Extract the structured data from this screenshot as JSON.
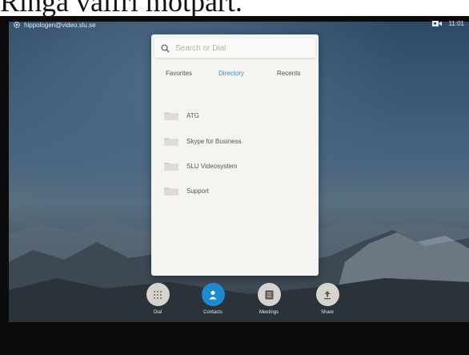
{
  "caption": "Ringa valfri motpart.",
  "status": {
    "account": "hippologen@video.slu.se",
    "time": "11:01"
  },
  "search": {
    "placeholder": "Search or Dial"
  },
  "tabs": [
    {
      "label": "Favorites",
      "active": false
    },
    {
      "label": "Directory",
      "active": true
    },
    {
      "label": "Recents",
      "active": false
    }
  ],
  "directory": {
    "items": [
      {
        "label": "ATG",
        "icon": "folder-icon"
      },
      {
        "label": "Skype for Business",
        "icon": "folder-icon"
      },
      {
        "label": "SLU Videosystem",
        "icon": "folder-icon"
      },
      {
        "label": "Support",
        "icon": "folder-icon"
      }
    ]
  },
  "dock": {
    "items": [
      {
        "label": "Dial",
        "icon": "dialpad-icon"
      },
      {
        "label": "Contacts",
        "icon": "person-icon",
        "active": true
      },
      {
        "label": "Meetings",
        "icon": "calendar-icon"
      },
      {
        "label": "Share",
        "icon": "upload-icon"
      }
    ]
  },
  "colors": {
    "accent": "#3a8ad6",
    "active_button": "#1f8ad0",
    "panel": "#f6f4f1"
  }
}
